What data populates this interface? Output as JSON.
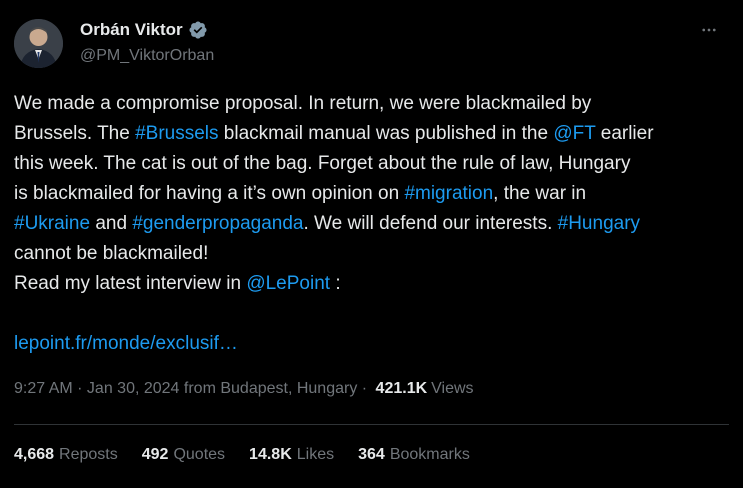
{
  "author": {
    "name": "Orbán Viktor",
    "handle": "@PM_ViktorOrban",
    "verified": true,
    "avatar_icon": "person-in-suit-avatar"
  },
  "menu": {
    "more_icon": "ellipsis-icon"
  },
  "tweet": {
    "lines": [
      [
        {
          "t": "We made a compromise proposal. In return, we were blackmailed by",
          "link": false
        }
      ],
      [
        {
          "t": "Brussels. The ",
          "link": false
        },
        {
          "t": "#Brussels",
          "link": true
        },
        {
          "t": " blackmail manual was published in the ",
          "link": false
        },
        {
          "t": "@FT",
          "link": true
        },
        {
          "t": " earlier",
          "link": false
        }
      ],
      [
        {
          "t": "this week. The cat is out of the bag. Forget about the rule of law, Hungary",
          "link": false
        }
      ],
      [
        {
          "t": "is blackmailed for having a it’s own opinion on ",
          "link": false
        },
        {
          "t": "#migration",
          "link": true
        },
        {
          "t": ", the war in",
          "link": false
        }
      ],
      [
        {
          "t": "#Ukraine",
          "link": true
        },
        {
          "t": " and ",
          "link": false
        },
        {
          "t": "#genderpropaganda",
          "link": true
        },
        {
          "t": ". We will defend our interests. ",
          "link": false
        },
        {
          "t": "#Hungary",
          "link": true
        }
      ],
      [
        {
          "t": "cannot be blackmailed!",
          "link": false
        }
      ],
      [
        {
          "t": "Read my latest interview in ",
          "link": false
        },
        {
          "t": "@LePoint",
          "link": true
        },
        {
          "t": " :",
          "link": false
        }
      ],
      [],
      [
        {
          "t": "lepoint.fr/monde/exclusif…",
          "link": true
        }
      ]
    ]
  },
  "meta": {
    "time": "9:27 AM",
    "separator1": " · ",
    "date": "Jan 30, 2024",
    "location": " from Budapest, Hungary",
    "separator2": " · ",
    "views_count": "421.1K",
    "views_label": "Views"
  },
  "stats": {
    "reposts": {
      "num": "4,668",
      "label": "Reposts"
    },
    "quotes": {
      "num": "492",
      "label": "Quotes"
    },
    "likes": {
      "num": "14.8K",
      "label": "Likes"
    },
    "bookmarks": {
      "num": "364",
      "label": "Bookmarks"
    }
  },
  "colors": {
    "background": "#000000",
    "text": "#e7e9ea",
    "muted": "#71767b",
    "link": "#1d9bf0",
    "divider": "#2f3336"
  }
}
